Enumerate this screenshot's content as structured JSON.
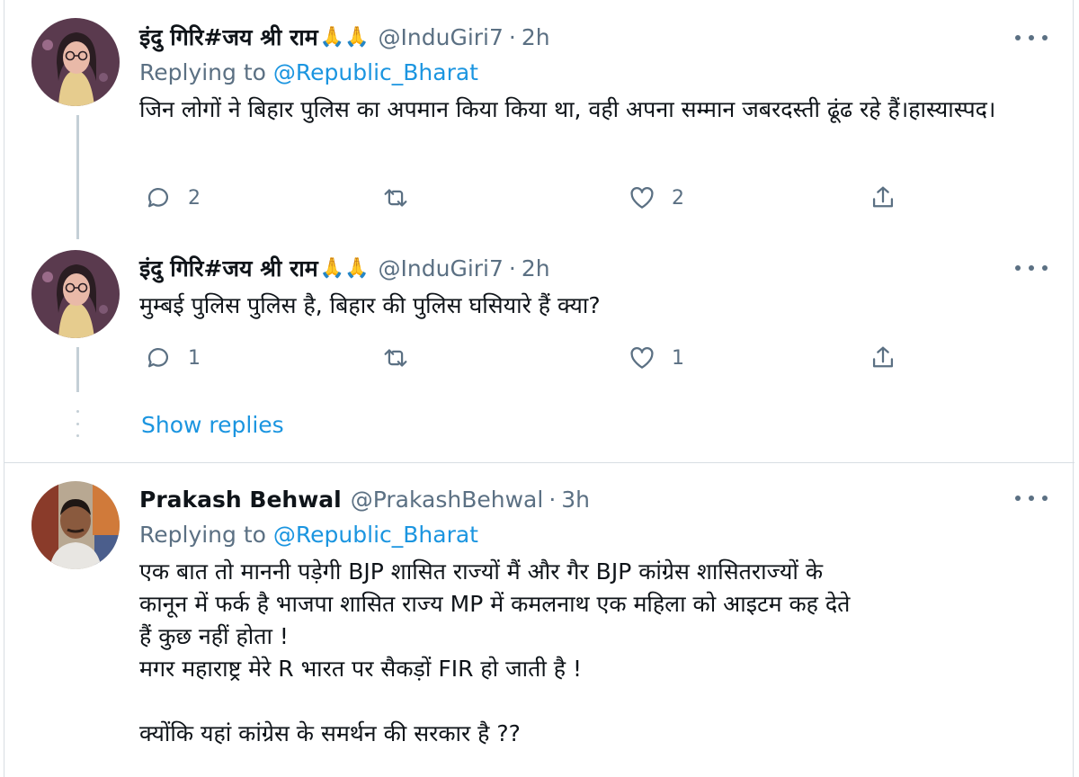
{
  "tweets": [
    {
      "name": "इंदु गिरि#जय श्री राम",
      "emoji": "🙏🙏",
      "handle": "@InduGiri7",
      "dot": "·",
      "time": "2h",
      "replying_prefix": "Replying to",
      "replying_to": "@Republic_Bharat",
      "text": "जिन लोगों ने बिहार पुलिस का अपमान किया किया था, वही अपना सम्मान जबरदस्ती ढूंढ रहे हैं।हास्यास्पद।",
      "counts": {
        "reply": "2",
        "retweet": "",
        "like": "2"
      }
    },
    {
      "name": "इंदु गिरि#जय श्री राम",
      "emoji": "🙏🙏",
      "handle": "@InduGiri7",
      "dot": "·",
      "time": "2h",
      "text": "मुम्बई पुलिस पुलिस है, बिहार की पुलिस घसियारे हैं क्या?",
      "counts": {
        "reply": "1",
        "retweet": "",
        "like": "1"
      }
    },
    {
      "name": "Prakash Behwal",
      "handle": "@PrakashBehwal",
      "dot": "·",
      "time": "3h",
      "replying_prefix": "Replying to",
      "replying_to": "@Republic_Bharat",
      "text": "एक बात तो माननी पड़ेगी BJP शासित राज्यों मैं और गैर BJP कांग्रेस शासितराज्यों के\nकानून में फर्क है भाजपा शासित राज्य MP में कमलनाथ एक महिला को आइटम कह देते\nहैं कुछ नहीं होता !\nमगर महाराष्ट्र मेरे R भारत पर सैकड़ों FIR हो जाती है !\n\nक्योंकि यहां कांग्रेस के समर्थन की सरकार है ??"
    }
  ],
  "show_replies": "Show replies",
  "icons": {
    "reply": "reply-icon",
    "retweet": "retweet-icon",
    "like": "heart-icon",
    "share": "share-icon",
    "more": "more-icon"
  },
  "colors": {
    "link": "#1b95e0",
    "secondary": "#5b7083",
    "thread_line": "#c4cfd6"
  }
}
